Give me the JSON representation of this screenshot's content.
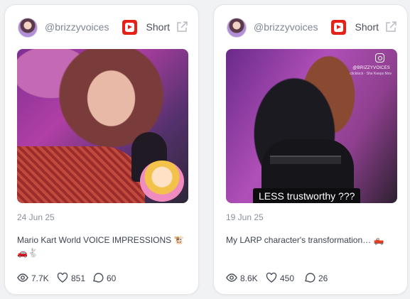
{
  "cards": [
    {
      "handle": "@brizzyvoices",
      "platform_label": "Short",
      "platform_icon": "youtube-icon",
      "date": "24 Jun 25",
      "title": "Mario Kart World VOICE IMPRESSIONS 🐮🚗🐇",
      "views": "7.7K",
      "likes": "851",
      "comments": "60"
    },
    {
      "handle": "@brizzyvoices",
      "platform_label": "Short",
      "platform_icon": "youtube-icon",
      "date": "19 Jun 25",
      "title": "My LARP character's transformation… 🛻",
      "views": "8.6K",
      "likes": "450",
      "comments": "26",
      "thumbnail_overlay": "LESS trustworthy ???",
      "thumbnail_handle": "@BRIZZYVOICES",
      "thumbnail_caption": "clicktock · She Keeps Mov"
    }
  ],
  "colors": {
    "youtube_red": "#e62117",
    "card_background": "#ffffff",
    "page_background": "#f1f2f4",
    "text_muted": "#8b919c"
  }
}
